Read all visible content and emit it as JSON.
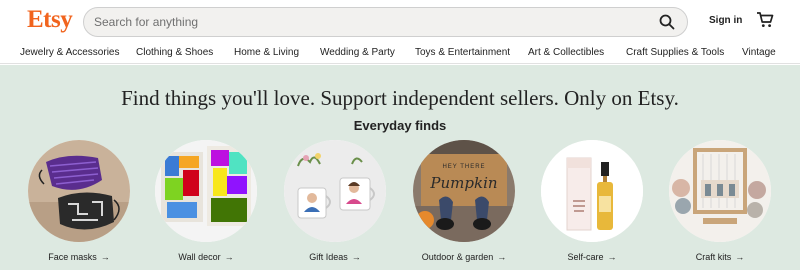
{
  "header": {
    "logo": "Etsy",
    "search_placeholder": "Search for anything",
    "signin": "Sign in"
  },
  "nav": [
    "Jewelry & Accessories",
    "Clothing & Shoes",
    "Home & Living",
    "Wedding & Party",
    "Toys & Entertainment",
    "Art & Collectibles",
    "Craft Supplies & Tools",
    "Vintage"
  ],
  "hero": {
    "tagline": "Find things you'll love. Support independent sellers. Only on Etsy.",
    "subheading": "Everyday finds"
  },
  "categories": [
    {
      "label": "Face masks",
      "arrow": "→"
    },
    {
      "label": "Wall decor",
      "arrow": "→"
    },
    {
      "label": "Gift Ideas",
      "arrow": "→"
    },
    {
      "label": "Outdoor & garden",
      "arrow": "→"
    },
    {
      "label": "Self-care",
      "arrow": "→"
    },
    {
      "label": "Craft kits",
      "arrow": "→"
    }
  ],
  "images": {
    "doormat_text_top": "HEY THERE",
    "doormat_text_main": "Pumpkin"
  },
  "colors": {
    "brand": "#f1641e",
    "hero_bg": "#dde9e1"
  }
}
